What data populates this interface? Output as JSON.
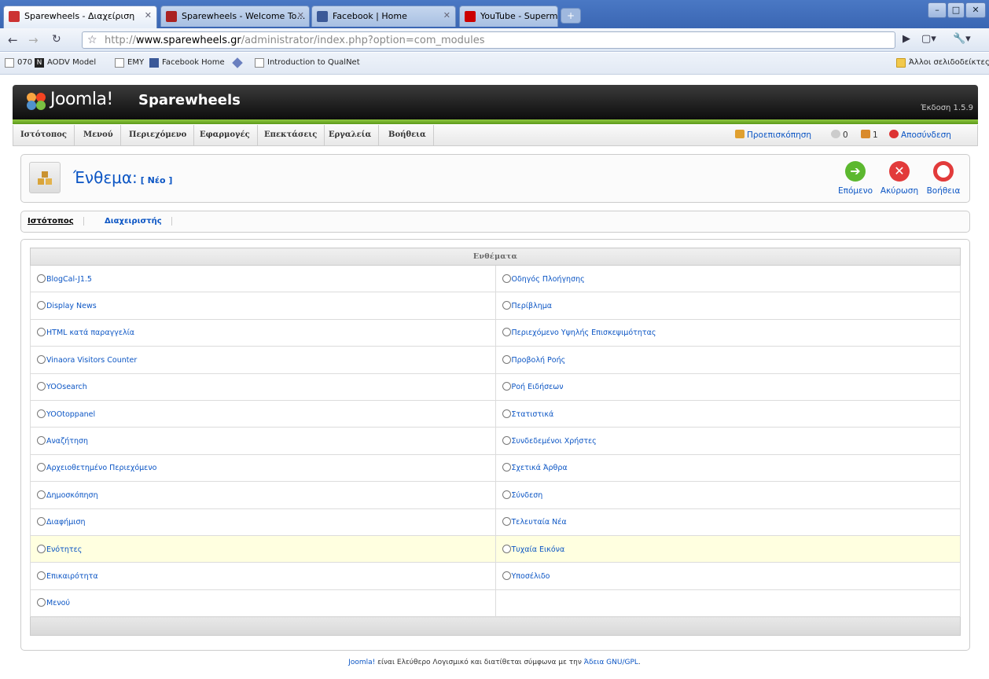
{
  "browser": {
    "tabs": [
      {
        "title": "Sparewheels - Διαχείριση",
        "favicon_color": "#cc3333",
        "active": true
      },
      {
        "title": "Sparewheels - Welcome To…",
        "favicon_color": "#aa2222",
        "active": false
      },
      {
        "title": "Facebook | Home",
        "favicon_color": "#3b5998",
        "active": false
      },
      {
        "title": "YouTube - Supermassive Bl…",
        "favicon_color": "#cc0000",
        "active": false
      }
    ],
    "new_tab_icon": "+",
    "url_host": "http://www.sparewheels.gr",
    "url_host_bold": "www.sparewheels.gr",
    "url_path": "/administrator/index.php?option=com_modules",
    "bookmarks": [
      {
        "label": "070",
        "icon": "page-icon"
      },
      {
        "label": "AODV Model",
        "icon": "n-icon"
      },
      {
        "label": "EMY",
        "icon": "page-icon"
      },
      {
        "label": "Facebook Home",
        "icon": "facebook-icon"
      },
      {
        "label": "",
        "icon": "diamond-icon"
      },
      {
        "label": "Introduction to QualNet",
        "icon": "page-icon"
      }
    ],
    "other_bookmarks": "Άλλοι σελιδοδείκτες"
  },
  "joomla": {
    "logo_text": "Joomla!",
    "site_name": "Sparewheels",
    "version": "Έκδοση 1.5.9",
    "menu": [
      "Ιστότοπος",
      "Μενού",
      "Περιεχόμενο",
      "Εφαρμογές",
      "Επεκτάσεις",
      "Εργαλεία",
      "Βοήθεια"
    ],
    "status": {
      "preview": "Προεπισκόπηση",
      "messages": "0",
      "users": "1",
      "logout": "Αποσύνδεση"
    }
  },
  "toolbar": {
    "title": "Ένθεμα:",
    "subtitle": "[ Νέο ]",
    "next_label": "Επόμενο",
    "cancel_label": "Ακύρωση",
    "help_label": "Βοήθεια"
  },
  "subtabs": {
    "site": "Ιστότοπος",
    "admin": "Διαχειριστής"
  },
  "modules": {
    "header": "Ενθέματα",
    "left": [
      "BlogCal-J1.5",
      "Display News",
      "HTML κατά παραγγελία",
      "Vinaora Visitors Counter",
      "YOOsearch",
      "YOOtoppanel",
      "Αναζήτηση",
      "Αρχειοθετημένο Περιεχόμενο",
      "Δημοσκόπηση",
      "Διαφήμιση",
      "Ενότητες",
      "Επικαιρότητα",
      "Μενού"
    ],
    "right": [
      "Οδηγός Πλοήγησης",
      "Περίβλημα",
      "Περιεχόμενο Υψηλής Επισκεψιμότητας",
      "Προβολή Ροής",
      "Ροή Ειδήσεων",
      "Στατιστικά",
      "Συνδεδεμένοι Χρήστες",
      "Σχετικά Άρθρα",
      "Σύνδεση",
      "Τελευταία Νέα",
      "Τυχαία Εικόνα",
      "Υποσέλιδο",
      ""
    ]
  },
  "footer": {
    "brand": "Joomla!",
    "text": " είναι Ελεύθερο Λογισμικό και διατίθεται σύμφωνα με την ",
    "license": "Άδεια GNU/GPL",
    "end": "."
  }
}
